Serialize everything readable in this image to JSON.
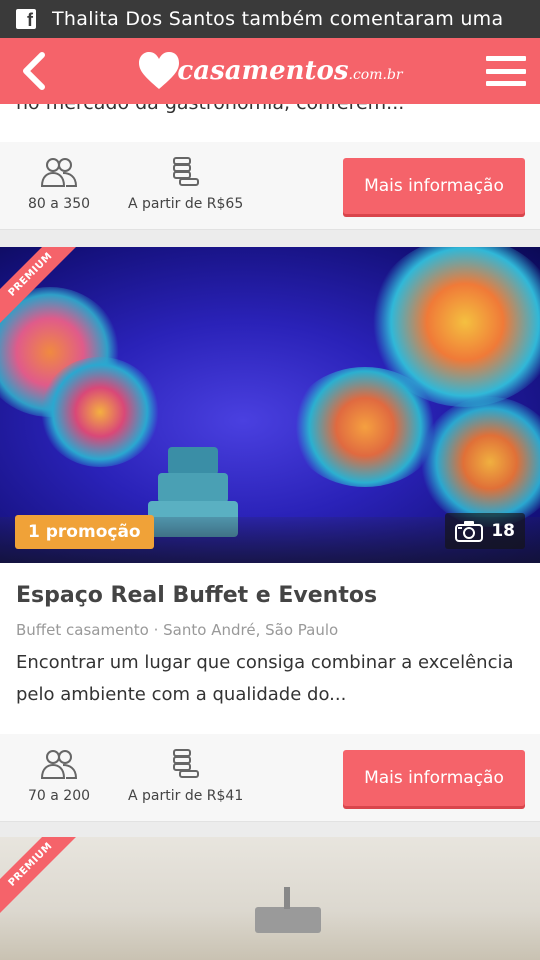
{
  "status_bar": {
    "notification_text": "Thalita Dos Santos também comentaram uma"
  },
  "header": {
    "logo_text": "casamentos",
    "logo_tld": ".com.br",
    "brand_color": "#f5636a"
  },
  "previous_card": {
    "description_tail": "no mercado da gastronomia, conferem...",
    "capacity": "80 a 350",
    "price": "A partir de R$65",
    "cta_label": "Mais informação"
  },
  "venue_card": {
    "ribbon": "PREMIUM",
    "promo_badge": "1 promoção",
    "photo_count": "18",
    "title": "Espaço Real Buffet e Eventos",
    "meta": "Buffet casamento · Santo André, São Paulo",
    "description": "Encontrar um lugar que consiga combinar a excelência pelo ambiente com a qualidade do...",
    "capacity": "70 a 200",
    "price": "A partir de R$41",
    "cta_label": "Mais informação"
  },
  "next_card": {
    "ribbon": "PREMIUM"
  },
  "icons": {
    "status": "facebook-icon",
    "back": "back-arrow-icon",
    "logo": "heart-logo-icon",
    "menu": "hamburger-menu-icon",
    "capacity": "people-icon",
    "price": "coins-icon",
    "photos": "camera-icon"
  }
}
